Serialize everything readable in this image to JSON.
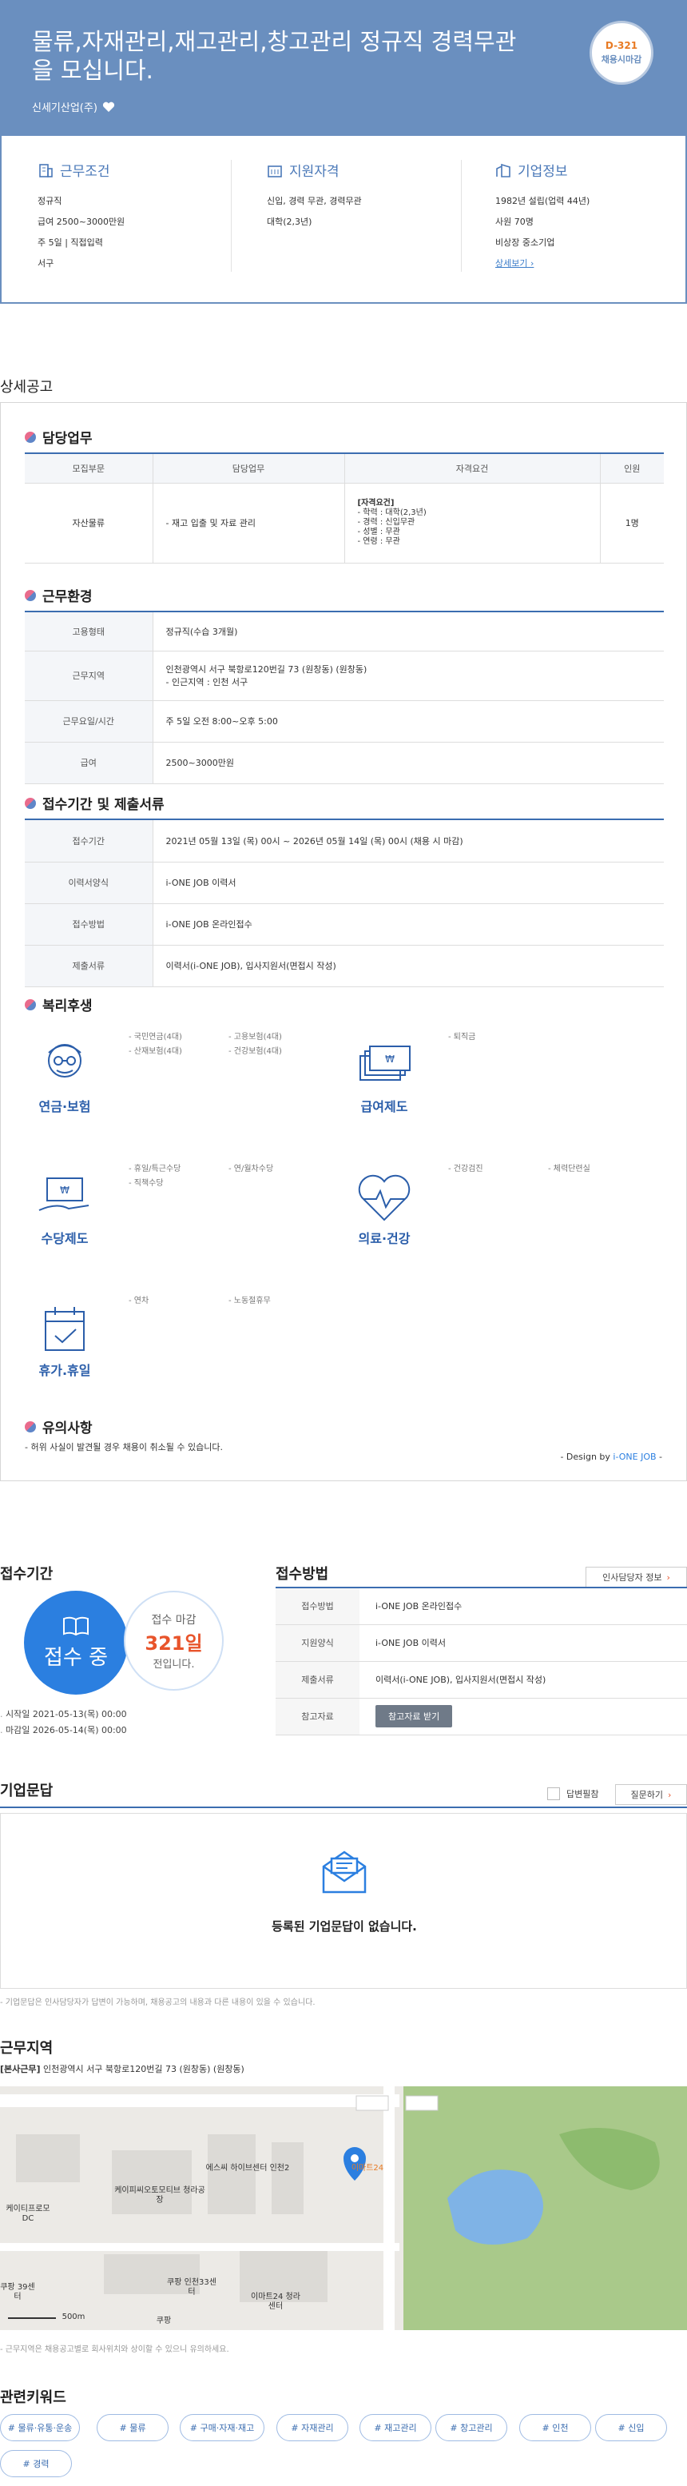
{
  "hero": {
    "title": "물류,자재관리,재고관리,창고관리 정규직 경력무관을 모십니다.",
    "company": "신세기산업(주)",
    "dday": "D-321",
    "dday_sub": "채용시마감",
    "bg_color": "#6a8fbf"
  },
  "summary": {
    "conditions": {
      "title": "근무조건",
      "lines": [
        "정규직",
        "급여 2500~3000만원",
        "주 5일 | 직접입력",
        "서구"
      ]
    },
    "qualifications": {
      "title": "지원자격",
      "lines": [
        "신입, 경력 무관, 경력무관",
        "대학(2,3년)"
      ]
    },
    "company_info": {
      "title": "기업정보",
      "lines": [
        "1982년 설립(업력 44년)",
        "사원 70명",
        "비상장 중소기업"
      ],
      "link": "상세보기"
    }
  },
  "detail_heading": "상세공고",
  "duties": {
    "title": "담당업무",
    "headers": [
      "모집부문",
      "담당업무",
      "자격요건",
      "인원"
    ],
    "row": {
      "division": "자산물류",
      "task": "- 재고 입출 및 자료 관리",
      "req_title": "[자격요건]",
      "req_lines": [
        "- 학력 : 대학(2,3년)",
        "- 경력 : 신입무관",
        "- 성별 : 무관",
        "- 연령 : 무관"
      ],
      "count": "1명"
    }
  },
  "environment": {
    "title": "근무환경",
    "rows": [
      {
        "k": "고용형태",
        "v": "정규직(수습 3개월)"
      },
      {
        "k": "근무지역",
        "v": "인천광역시 서구 북항로120번길 73 (원창동) (원창동)",
        "v2": "- 인근지역 : 인천 서구"
      },
      {
        "k": "근무요일/시간",
        "v": "주 5일 오전 8:00~오후 5:00"
      },
      {
        "k": "급여",
        "v": "2500~3000만원"
      }
    ]
  },
  "period_docs": {
    "title": "접수기간 및 제출서류",
    "rows": [
      {
        "k": "접수기간",
        "v": "2021년 05월 13일 (목) 00시 ~ 2026년 05월 14일 (목) 00시 (채용 시 마감)"
      },
      {
        "k": "이력서양식",
        "v": "i-ONE JOB 이력서"
      },
      {
        "k": "접수방법",
        "v": "i-ONE JOB 온라인접수"
      },
      {
        "k": "제출서류",
        "v": "이력서(i-ONE JOB), 입사지원서(면접시 작성)"
      }
    ]
  },
  "welfare": {
    "title": "복리후생",
    "groups": [
      {
        "label": "연금·보험",
        "icon": "person-glasses-icon",
        "items": [
          "- 국민연금(4대)",
          "- 고용보험(4대)",
          "- 산재보험(4대)",
          "- 건강보험(4대)"
        ]
      },
      {
        "label": "급여제도",
        "icon": "money-icon",
        "items": [
          "- 퇴직금"
        ]
      },
      {
        "label": "수당제도",
        "icon": "money-hand-icon",
        "items": [
          "- 휴일/특근수당",
          "- 연/월차수당",
          "- 직책수당"
        ]
      },
      {
        "label": "의료·건강",
        "icon": "heart-pulse-icon",
        "items": [
          "- 건강검진",
          "- 체력단련실"
        ]
      },
      {
        "label": "휴가.휴일",
        "icon": "calendar-check-icon",
        "items": [
          "- 연차",
          "- 노동절휴무"
        ]
      }
    ]
  },
  "caution": {
    "title": "유의사항",
    "text": "- 허위 사실이 발견될 경우 채용이 취소될 수 있습니다.",
    "design_prefix": "- Design by ",
    "design_brand": "i-ONE JOB",
    "design_suffix": " -"
  },
  "apply_period": {
    "title": "접수기간",
    "status": "접수 중",
    "side_a": "접수 마감",
    "side_b": "321일",
    "side_c": "전입니다.",
    "start": "시작일 2021-05-13(목) 00:00",
    "end": "마감일 2026-05-14(목) 00:00"
  },
  "apply_method": {
    "title": "접수방법",
    "contact_button": "인사담당자 정보",
    "rows": [
      {
        "k": "접수방법",
        "v": "i-ONE JOB 온라인접수"
      },
      {
        "k": "지원양식",
        "v": "i-ONE JOB 이력서"
      },
      {
        "k": "제출서류",
        "v": "이력서(i-ONE JOB), 입사지원서(면접시 작성)"
      }
    ],
    "ref_label": "참고자료",
    "ref_button": "참고자료 받기"
  },
  "qa": {
    "title": "기업문답",
    "answered_label": "답변필참",
    "ask_button": "질문하기",
    "empty": "등록된 기업문답이 없습니다.",
    "note": "- 기업문답은 인사담당자가 답변이 가능하며, 채용공고의 내용과 다른 내용이 있을 수 있습니다."
  },
  "location": {
    "title": "근무지역",
    "tag": "[본사근무]",
    "address": "인천광역시 서구 북항로120번길 73 (원창동) (원창동)",
    "map_labels": [
      "케이티프로모 DC",
      "케이피씨오토모티브 청라공장",
      "에스씨 하이브센터 인천2",
      "이마트24",
      "쿠팡 39센터",
      "쿠팡 인천33센터",
      "쿠팡",
      "이마트24 청라센터",
      "500m"
    ],
    "note": "- 근무지역은 채용공고별로 회사위치와 상이할 수 있으니 유의하세요."
  },
  "keywords": {
    "title": "관련키워드",
    "items": [
      "# 물류·유통·운송",
      "# 물류",
      "# 구매·자재·재고",
      "# 자재관리",
      "# 재고관리",
      "# 창고관리",
      "# 인천",
      "# 신입",
      "# 경력"
    ]
  }
}
